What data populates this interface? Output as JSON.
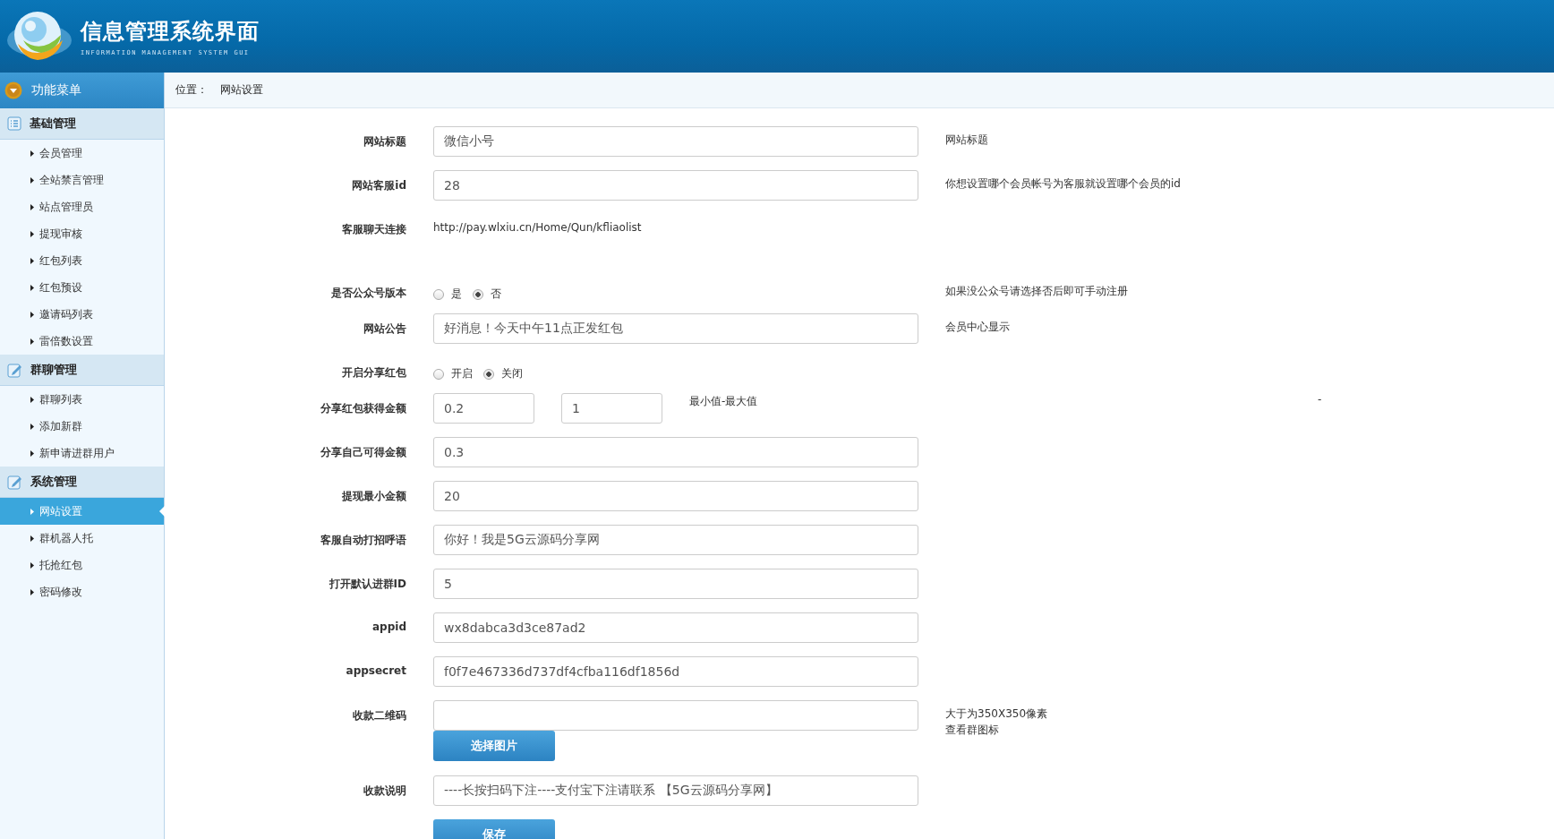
{
  "header": {
    "title": "信息管理系统界面",
    "subtitle": "INFORMATION MANAGEMENT SYSTEM GUI"
  },
  "sidebar": {
    "title": "功能菜单",
    "groups": [
      {
        "label": "基础管理",
        "kind": "list",
        "items": [
          {
            "label": "会员管理",
            "selected": false
          },
          {
            "label": "全站禁言管理",
            "selected": false
          },
          {
            "label": "站点管理员",
            "selected": false
          },
          {
            "label": "提现审核",
            "selected": false
          },
          {
            "label": "红包列表",
            "selected": false
          },
          {
            "label": "红包预设",
            "selected": false
          },
          {
            "label": "邀请码列表",
            "selected": false
          },
          {
            "label": "雷倍数设置",
            "selected": false
          }
        ]
      },
      {
        "label": "群聊管理",
        "kind": "edit",
        "items": [
          {
            "label": "群聊列表",
            "selected": false
          },
          {
            "label": "添加新群",
            "selected": false
          },
          {
            "label": "新申请进群用户",
            "selected": false
          }
        ]
      },
      {
        "label": "系统管理",
        "kind": "edit",
        "items": [
          {
            "label": "网站设置",
            "selected": true
          },
          {
            "label": "群机器人托",
            "selected": false
          },
          {
            "label": "托抢红包",
            "selected": false
          },
          {
            "label": "密码修改",
            "selected": false
          }
        ]
      }
    ]
  },
  "breadcrumb": {
    "label": "位置：",
    "value": "网站设置"
  },
  "form": {
    "rows": [
      {
        "kind": "input",
        "label": "网站标题",
        "value": "微信小号",
        "notes": [
          "网站标题"
        ]
      },
      {
        "kind": "input",
        "label": "网站客服id",
        "value": "28",
        "notes": [
          "你想设置哪个会员帐号为客服就设置哪个会员的id"
        ]
      },
      {
        "kind": "link",
        "label": "客服聊天连接",
        "value": "http://pay.wlxiu.cn/Home/Qun/kfliaolist"
      },
      {
        "kind": "radio",
        "label": "是否公众号版本",
        "options": [
          {
            "label": "是",
            "selected": false
          },
          {
            "label": "否",
            "selected": true
          }
        ],
        "notes": [
          "如果没公众号请选择否后即可手动注册"
        ]
      },
      {
        "kind": "input",
        "label": "网站公告",
        "value": "好消息！今天中午11点正发红包",
        "notes": [
          "会员中心显示"
        ]
      },
      {
        "kind": "radio",
        "label": "开启分享红包",
        "options": [
          {
            "label": "开启",
            "selected": false
          },
          {
            "label": "关闭",
            "selected": true
          }
        ]
      },
      {
        "kind": "range",
        "label": "分享红包获得金额",
        "min": "0.2",
        "max": "1",
        "hint": "最小值-最大值",
        "notes": [
          "-"
        ]
      },
      {
        "kind": "input",
        "label": "分享自己可得金额",
        "value": "0.3"
      },
      {
        "kind": "input",
        "label": "提现最小金额",
        "value": "20"
      },
      {
        "kind": "input",
        "label": "客服自动打招呼语",
        "value": "你好！我是5G云源码分享网"
      },
      {
        "kind": "input",
        "label": "打开默认进群ID",
        "value": "5"
      },
      {
        "kind": "input",
        "label": "appid",
        "value": "wx8dabca3d3ce87ad2"
      },
      {
        "kind": "input",
        "label": "appsecret",
        "value": "f0f7e467336d737df4cfba116df1856d"
      },
      {
        "kind": "file",
        "label": "收款二维码",
        "button": "选择图片",
        "notes": [
          "大于为350X350像素",
          "查看群图标"
        ]
      },
      {
        "kind": "input",
        "label": "收款说明",
        "value": "----长按扫码下注----支付宝下注请联系 【5G云源码分享网】"
      }
    ],
    "save_button": "保存"
  }
}
